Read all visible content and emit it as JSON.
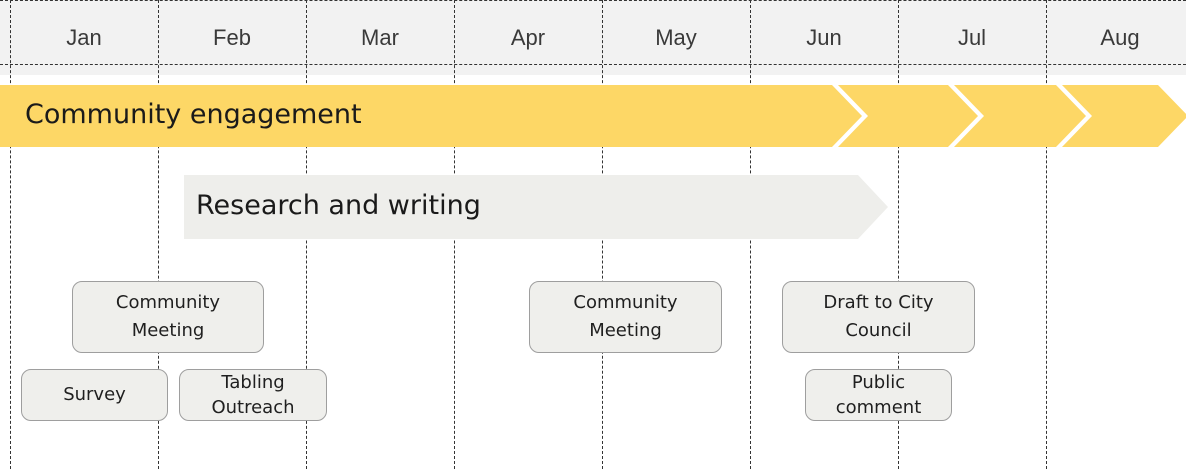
{
  "months": [
    "Jan",
    "Feb",
    "Mar",
    "Apr",
    "May",
    "Jun",
    "Jul",
    "Aug"
  ],
  "bars": {
    "community_engagement": "Community engagement",
    "research_writing": "Research and writing"
  },
  "events": {
    "community_meeting_1": "Community Meeting",
    "survey": "Survey",
    "tabling_outreach": "Tabling Outreach",
    "community_meeting_2": "Community Meeting",
    "draft_to_council": "Draft to City Council",
    "public_comment": "Public comment"
  },
  "colors": {
    "engagement_bar": "#fdd766",
    "research_bar": "#eeeeeb",
    "header_bg": "#f2f2f2",
    "event_box": "#efefec"
  }
}
